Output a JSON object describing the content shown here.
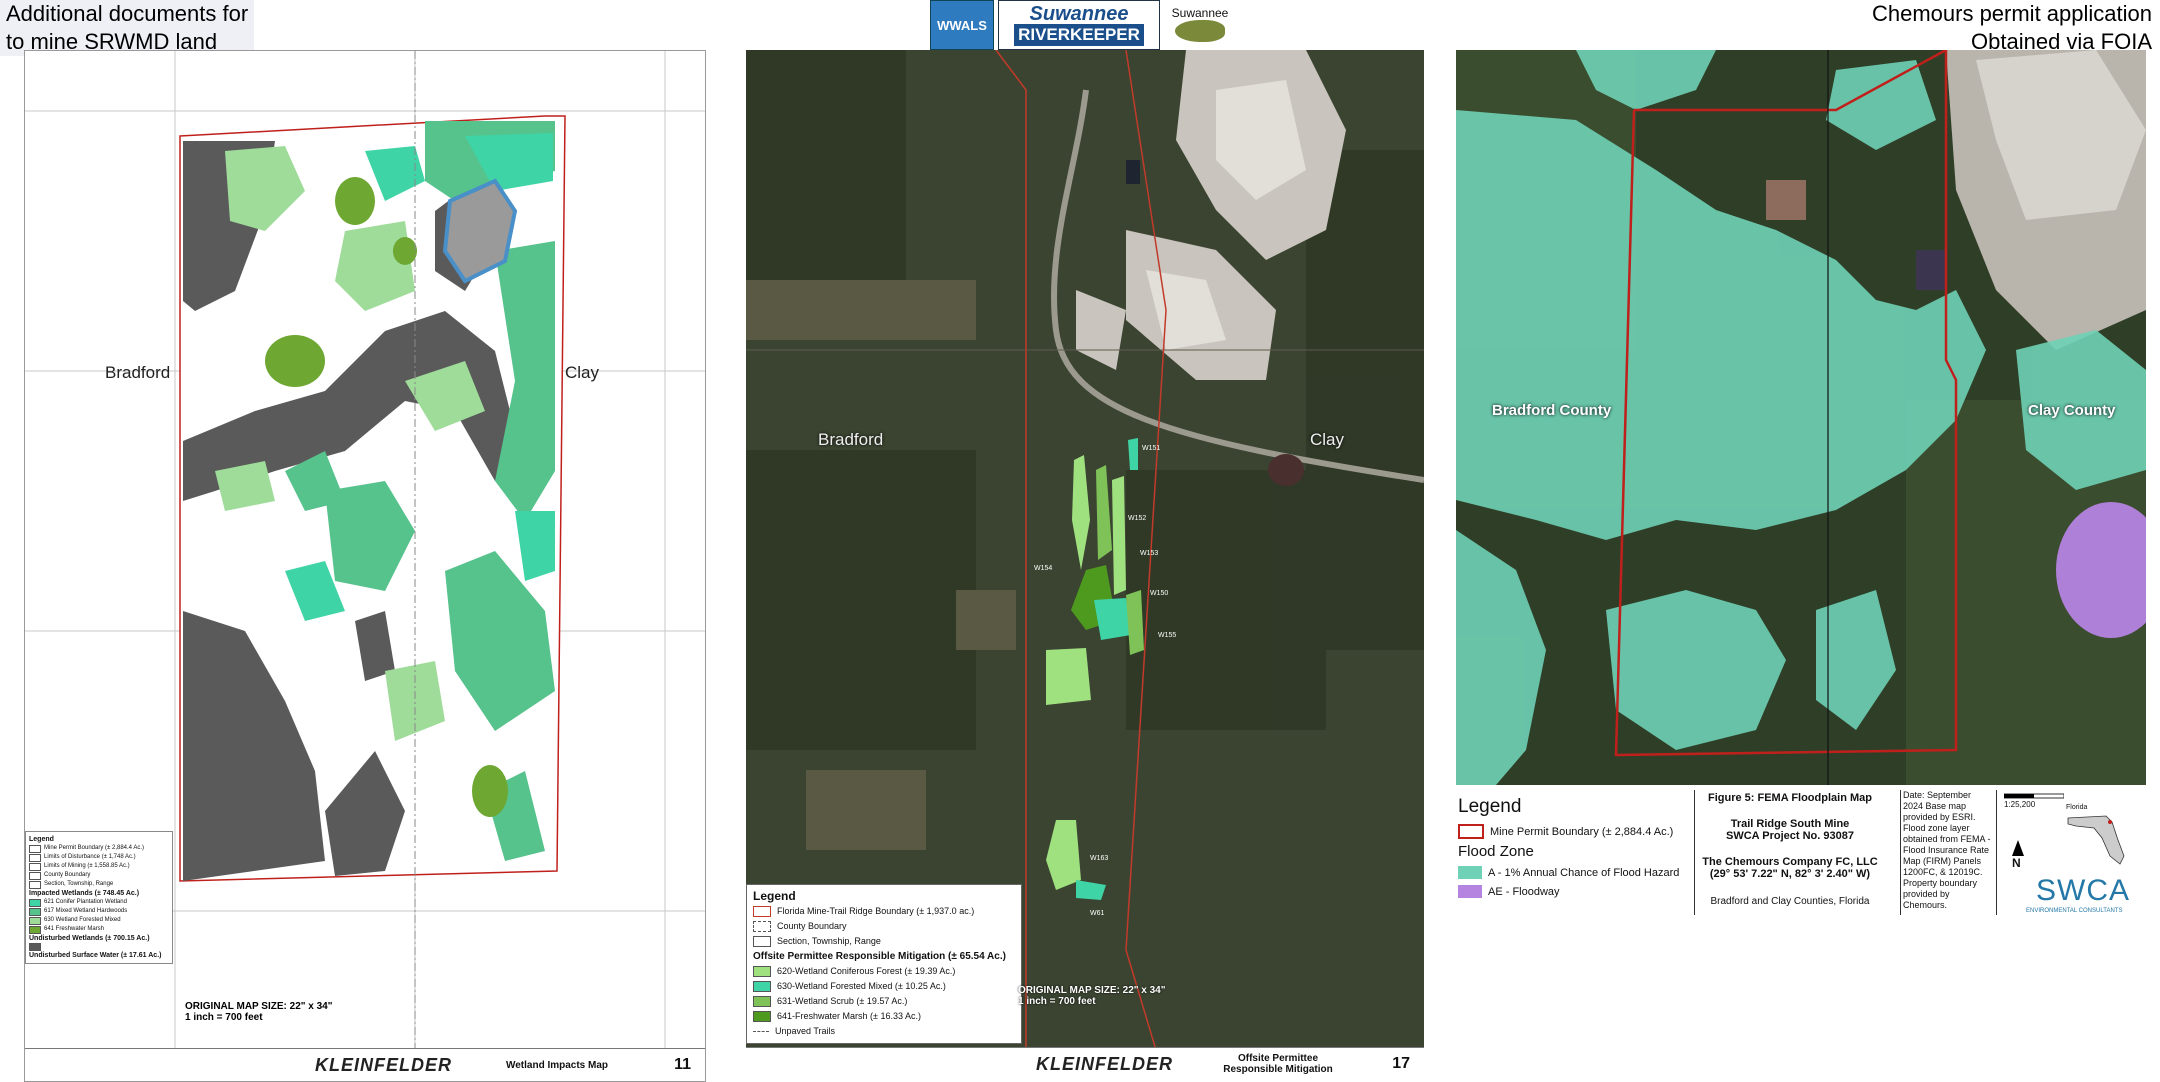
{
  "header": {
    "left_line1": "Additional documents for",
    "left_line2": "to mine SRWMD land",
    "right_line1": "Chemours permit application",
    "right_line2": "Obtained via FOIA"
  },
  "logos": {
    "wwals": "WWALS",
    "riverkeeper_top": "Suwannee",
    "riverkeeper_bottom": "RIVERKEEPER",
    "suwannee_small": "Suwannee"
  },
  "panel1": {
    "county_left": "Bradford",
    "county_right": "Clay",
    "legend_title": "Legend",
    "legend_items": [
      {
        "label": "Mine Permit Boundary (± 2,884.4 Ac.)",
        "color": "#ffffff"
      },
      {
        "label": "Limits of Disturbance (± 1,748 Ac.)",
        "color": "#ffffff"
      },
      {
        "label": "Limits of Mining (± 1,558.85 Ac.)",
        "color": "#ffffff"
      },
      {
        "label": "County Boundary",
        "color": "#ffffff"
      },
      {
        "label": "Section, Township, Range",
        "color": "#ffffff"
      }
    ],
    "impacted_title": "Impacted Wetlands (± 748.45 Ac.)",
    "impacted_items": [
      {
        "label": "621 Conifer Plantation Wetland",
        "color": "#3fd4a6"
      },
      {
        "label": "617 Mixed Wetland Hardwoods",
        "color": "#56c28c"
      },
      {
        "label": "630 Wetland Forested Mixed",
        "color": "#9fdc9a"
      },
      {
        "label": "641 Freshwater Marsh",
        "color": "#6ea832"
      }
    ],
    "undisturbed_title": "Undisturbed Wetlands (± 700.15 Ac.)",
    "surface_title": "Undisturbed Surface Water (± 17.61 Ac.)",
    "map_size": "ORIGINAL MAP SIZE: 22\" x 34\"",
    "scale": "1 inch = 700 feet",
    "firm": "KLEINFELDER",
    "title": "Wetland Impacts Map",
    "figure": "11"
  },
  "panel2": {
    "county_left": "Bradford",
    "county_right": "Clay",
    "legend_title": "Legend",
    "legend_items": [
      {
        "label": "Florida Mine-Trail Ridge Boundary (± 1,937.0 ac.)",
        "color": "#ffffff"
      },
      {
        "label": "County Boundary",
        "color": "#ffffff"
      },
      {
        "label": "Section, Township, Range",
        "color": "#ffffff"
      }
    ],
    "mitigation_title": "Offsite Permittee Responsible Mitigation (± 65.54 Ac.)",
    "mitigation_items": [
      {
        "label": "620-Wetland Coniferous Forest (± 19.39 Ac.)",
        "color": "#9fe07f"
      },
      {
        "label": "630-Wetland Forested Mixed (± 10.25 Ac.)",
        "color": "#3fd4a6"
      },
      {
        "label": "631-Wetland Scrub (± 19.57 Ac.)",
        "color": "#7fc257"
      },
      {
        "label": "641-Freshwater Marsh (± 16.33 Ac.)",
        "color": "#4e9a1f"
      }
    ],
    "trails": "Unpaved Trails",
    "map_size": "ORIGINAL MAP SIZE: 22\" x 34\"",
    "scale": "1 inch = 700 feet",
    "firm": "KLEINFELDER",
    "title": "Offsite Permittee Responsible Mitigation",
    "figure": "17",
    "labels": [
      "W151",
      "W152",
      "W153",
      "W154",
      "W150",
      "W155",
      "W163",
      "W61"
    ]
  },
  "panel3": {
    "county_left": "Bradford County",
    "county_right": "Clay County",
    "legend_title": "Legend",
    "boundary_label": "Mine Permit Boundary (± 2,884.4 Ac.)",
    "flood_zone_title": "Flood Zone",
    "zone_a": "A - 1% Annual Chance of Flood Hazard",
    "zone_ae": "AE - Floodway",
    "figure_title": "Figure 5: FEMA Floodplain Map",
    "site": "Trail Ridge South Mine",
    "project": "SWCA Project No. 93087",
    "company": "The Chemours Company FC, LLC",
    "coords": "(29° 53' 7.22\" N, 82° 3' 2.40\" W)",
    "counties": "Bradford and Clay Counties, Florida",
    "date_note": "Date: September 2024 Base map provided by ESRI. Flood zone layer obtained from FEMA - Flood Insurance Rate Map (FIRM) Panels 1200FC, & 12019C. Property boundary provided by Chemours.",
    "scale": "1:25,200",
    "north": "N",
    "state": "Florida",
    "firm": "SWCA",
    "firm_sub": "ENVIRONMENTAL CONSULTANTS",
    "colors": {
      "zone_a": "#6fd1b6",
      "zone_ae": "#b583e0",
      "boundary": "#c0201b"
    }
  }
}
